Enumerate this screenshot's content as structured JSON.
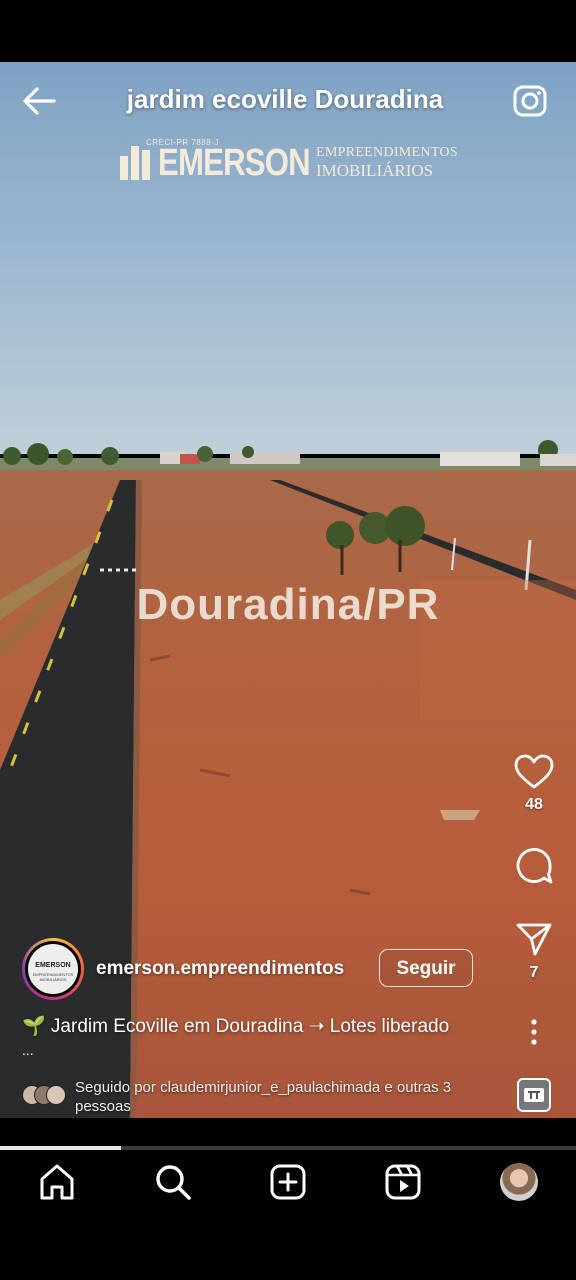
{
  "header": {
    "title": "jardim ecoville Douradina",
    "back_icon": "arrow-left-icon",
    "camera_icon": "camera-icon"
  },
  "watermark": {
    "creci": "CRECI-PR 7888-J",
    "brand": "EMERSON",
    "line1": "EMPREENDIMENTOS",
    "line2": "IMOBILIÁRIOS"
  },
  "video_overlay_text": "Douradina/PR",
  "actions": {
    "like_icon": "heart-icon",
    "like_count": "48",
    "comment_icon": "comment-icon",
    "share_icon": "send-icon",
    "share_count": "7",
    "more_icon": "more-vertical-icon"
  },
  "post": {
    "avatar_text": "EMERSON",
    "avatar_subtext": "EMPREENDIMENTOS IMOBILIÁRIOS",
    "username": "emerson.empreendimentos",
    "follow_label": "Seguir",
    "caption": "🌱 Jardim Ecoville  em Douradina ➝  Lotes liberado",
    "caption_more": "...",
    "followed_by": "Seguido por claudemirjunior_e_paulachimada e outras 3 pessoas"
  },
  "progress": 0.21,
  "nav": {
    "items": [
      "home-icon",
      "search-icon",
      "create-icon",
      "reels-icon",
      "profile-avatar"
    ]
  },
  "colors": {
    "accent": "#ffffff",
    "sky": "#9ab6cf",
    "soil": "#b85d3b",
    "asphalt": "#2a2b2d"
  }
}
